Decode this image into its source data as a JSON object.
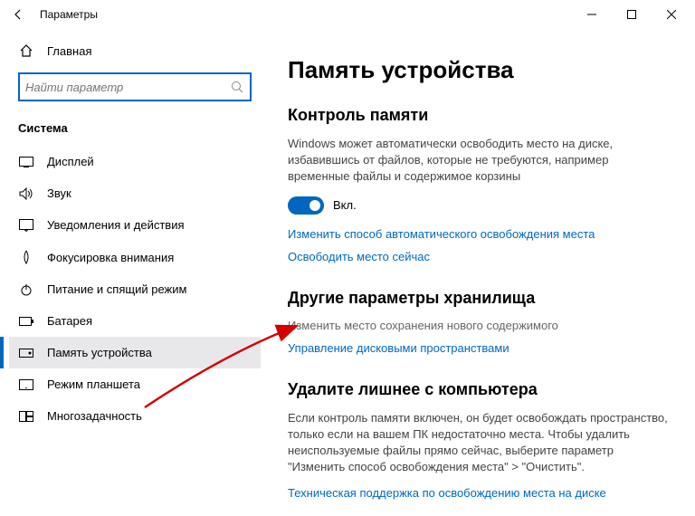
{
  "titlebar": {
    "title": "Параметры"
  },
  "sidebar": {
    "home_label": "Главная",
    "search_placeholder": "Найти параметр",
    "category": "Система",
    "items": [
      {
        "label": "Дисплей"
      },
      {
        "label": "Звук"
      },
      {
        "label": "Уведомления и действия"
      },
      {
        "label": "Фокусировка внимания"
      },
      {
        "label": "Питание и спящий режим"
      },
      {
        "label": "Батарея"
      },
      {
        "label": "Память устройства"
      },
      {
        "label": "Режим планшета"
      },
      {
        "label": "Многозадачность"
      }
    ]
  },
  "main": {
    "heading": "Память устройства",
    "storage_sense": {
      "title": "Контроль памяти",
      "desc": "Windows может автоматически освободить место на диске, избавившись от файлов, которые не требуются, например временные файлы и содержимое корзины",
      "toggle_label": "Вкл.",
      "link_change": "Изменить способ автоматического освобождения места",
      "link_free": "Освободить место сейчас"
    },
    "other": {
      "title": "Другие параметры хранилища",
      "link_change_location": "Изменить место сохранения нового содержимого",
      "link_manage_spaces": "Управление дисковыми пространствами"
    },
    "cleanup": {
      "title": "Удалите лишнее с компьютера",
      "desc": "Если контроль памяти включен, он будет освобождать пространство, только если на вашем ПК недостаточно места. Чтобы удалить неиспользуемые файлы прямо сейчас, выберите параметр \"Изменить способ освобождения места\" > \"Очистить\".",
      "link_support": "Техническая поддержка по освобождению места на диске"
    }
  }
}
